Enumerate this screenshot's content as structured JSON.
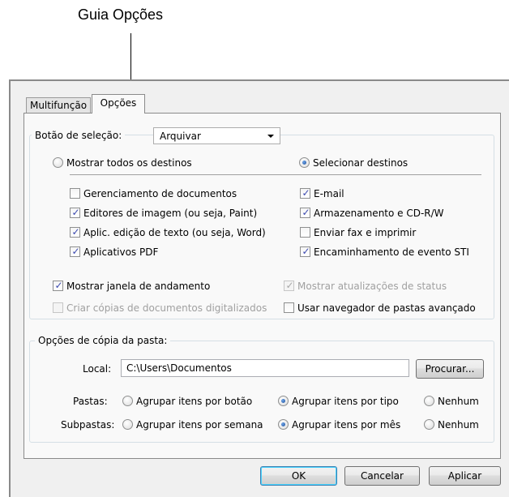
{
  "callout": "Guia Opções",
  "tabs": [
    {
      "label": "Multifunção",
      "active": false
    },
    {
      "label": "Opções",
      "active": true
    }
  ],
  "selection": {
    "label": "Botão de seleção:",
    "value": "Arquivar"
  },
  "destinations": {
    "radio_all": {
      "label": "Mostrar todos os destinos",
      "selected": false
    },
    "radio_select": {
      "label": "Selecionar destinos",
      "selected": true
    },
    "left": [
      {
        "label": "Gerenciamento de documentos",
        "checked": false
      },
      {
        "label": "Editores de imagem (ou seja, Paint)",
        "checked": true
      },
      {
        "label": "Aplic. edição de texto (ou seja, Word)",
        "checked": true
      },
      {
        "label": "Aplicativos PDF",
        "checked": true
      }
    ],
    "right": [
      {
        "label": "E-mail",
        "checked": true
      },
      {
        "label": "Armazenamento e CD-R/W",
        "checked": true
      },
      {
        "label": "Enviar fax e imprimir",
        "checked": false
      },
      {
        "label": "Encaminhamento de evento STI",
        "checked": true
      }
    ]
  },
  "options": {
    "show_progress": {
      "label": "Mostrar janela de andamento",
      "checked": true,
      "enabled": true
    },
    "show_status": {
      "label": "Mostrar atualizações de status",
      "checked": true,
      "enabled": false
    },
    "create_copies": {
      "label": "Criar cópias de documentos digitalizados",
      "checked": false,
      "enabled": false
    },
    "advanced_browser": {
      "label": "Usar navegador de pastas avançado",
      "checked": false,
      "enabled": true
    }
  },
  "folder_copy": {
    "title": "Opções de cópia da pasta:",
    "local_label": "Local:",
    "local_value": "C:\\Users\\Documentos",
    "browse_label": "Procurar...",
    "folders_label": "Pastas:",
    "folders_options": [
      {
        "label": "Agrupar itens por botão",
        "selected": false
      },
      {
        "label": "Agrupar itens por tipo",
        "selected": true
      },
      {
        "label": "Nenhum",
        "selected": false
      }
    ],
    "subfolders_label": "Subpastas:",
    "subfolders_options": [
      {
        "label": "Agrupar itens por semana",
        "selected": false
      },
      {
        "label": "Agrupar itens por mês",
        "selected": true
      },
      {
        "label": "Nenhum",
        "selected": false
      }
    ]
  },
  "buttons": {
    "ok": "OK",
    "cancel": "Cancelar",
    "apply": "Aplicar"
  },
  "check_glyph": "✓"
}
